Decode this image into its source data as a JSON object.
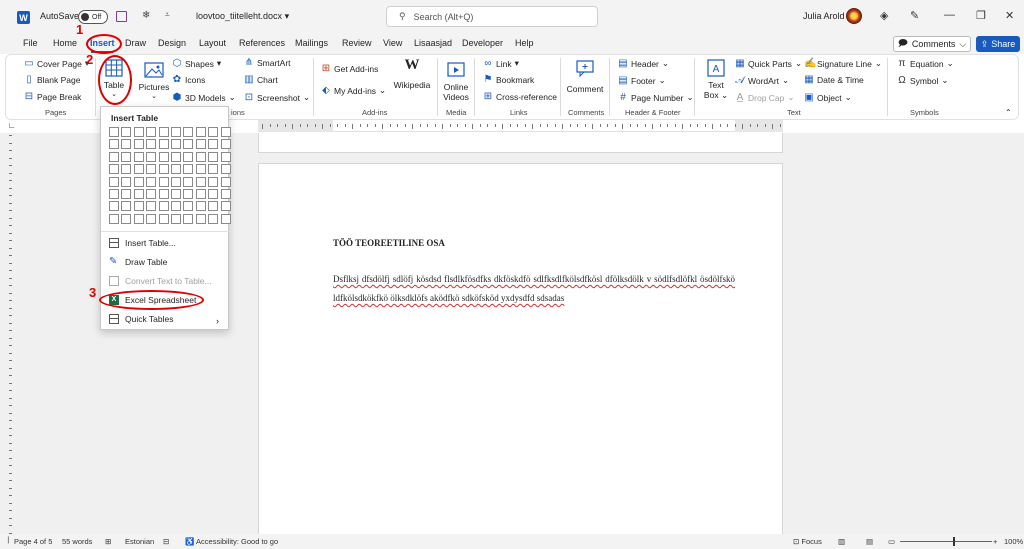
{
  "titlebar": {
    "autosave_label": "AutoSave",
    "autosave_state": "Off",
    "doc_title": "loovtoo_tiitelleht.docx",
    "search_placeholder": "Search (Alt+Q)",
    "user_name": "Julia Arold"
  },
  "tabs": [
    "File",
    "Home",
    "Insert",
    "Draw",
    "Design",
    "Layout",
    "References",
    "Mailings",
    "Review",
    "View",
    "Lisaasjad",
    "Developer",
    "Help"
  ],
  "active_tab": "Insert",
  "comments_label": "Comments",
  "share_label": "Share",
  "ribbon": {
    "pages": {
      "cover_page": "Cover Page",
      "blank_page": "Blank Page",
      "page_break": "Page Break",
      "group": "Pages"
    },
    "tables": {
      "table": "Table"
    },
    "illustrations": {
      "pictures": "Pictures",
      "shapes": "Shapes",
      "icons": "Icons",
      "models": "3D Models",
      "smartart": "SmartArt",
      "chart": "Chart",
      "screenshot": "Screenshot",
      "group_partial": "ions"
    },
    "addins": {
      "get_addins": "Get Add-ins",
      "my_addins": "My Add-ins",
      "wikipedia": "Wikipedia",
      "group": "Add-ins"
    },
    "media": {
      "online_videos_1": "Online",
      "online_videos_2": "Videos",
      "group": "Media"
    },
    "links": {
      "link": "Link",
      "bookmark": "Bookmark",
      "cross_ref": "Cross-reference",
      "group": "Links"
    },
    "comments": {
      "comment": "Comment",
      "group": "Comments"
    },
    "header_footer": {
      "header": "Header",
      "footer": "Footer",
      "page_number": "Page Number",
      "group": "Header & Footer"
    },
    "text": {
      "text_box_1": "Text",
      "text_box_2": "Box",
      "quick_parts": "Quick Parts",
      "wordart": "WordArt",
      "drop_cap": "Drop Cap",
      "signature_line": "Signature Line",
      "date_time": "Date & Time",
      "object": "Object",
      "group": "Text"
    },
    "symbols": {
      "equation": "Equation",
      "symbol": "Symbol",
      "group": "Symbols"
    }
  },
  "table_menu": {
    "title": "Insert Table",
    "items": [
      "Insert Table...",
      "Draw Table",
      "Convert Text to Table...",
      "Excel Spreadsheet",
      "Quick Tables"
    ]
  },
  "document": {
    "heading": "TÖÖ TEOREETILINE OSA",
    "paragraph": "Dsflksj dfsdölfj sdlöfj kösdsd flsdlkfösdfks dkföskdfö sdlfksdlfkölsdfkösl dfölksdölk v södlfsdlöfkl ösdölfskö ldfkölsdkökfkö ölksdklöfs aködfkö sdköfsköd yxdysdfd sdsadas"
  },
  "statusbar": {
    "page": "Page 4 of 5",
    "words": "55 words",
    "language": "Estonian",
    "accessibility": "Accessibility: Good to go",
    "focus": "Focus",
    "zoom": "100%"
  },
  "annotations": [
    "1",
    "2",
    "3"
  ],
  "colors": {
    "accent": "#185abd",
    "annotation": "#e00000"
  }
}
